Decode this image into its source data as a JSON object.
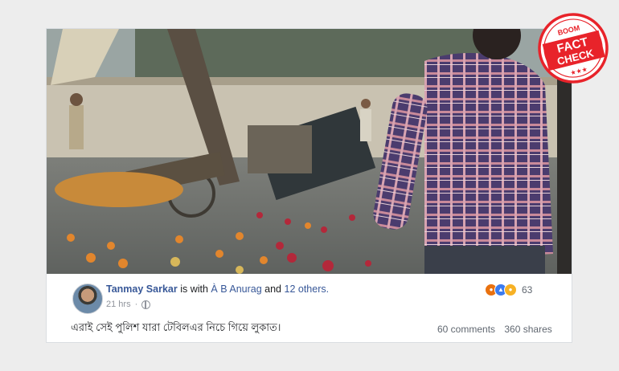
{
  "post": {
    "author": "Tanmay Sarkar",
    "with_text": "is with",
    "tagged": "À B Anurag",
    "and_text": "and",
    "others": "12 others.",
    "time": "21 hrs",
    "text": "এরাই সেই পুলিশ যারা টেবিলএর নিচে গিয়ে লুকাত।",
    "reactions_count": "63",
    "comments": "60 comments",
    "shares": "360 shares"
  },
  "stamp": {
    "brand": "BOOM",
    "line1": "FACT",
    "line2": "CHECK",
    "stars": "★★★",
    "color": "#e8232a"
  },
  "reaction_icons": [
    "angry-icon",
    "like-icon",
    "sad-icon"
  ]
}
